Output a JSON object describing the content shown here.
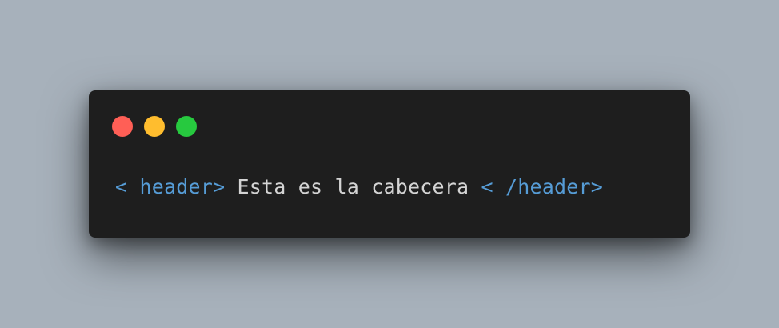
{
  "window": {
    "controls": [
      {
        "name": "close",
        "color": "#ff5f56"
      },
      {
        "name": "minimize",
        "color": "#ffbd2e"
      },
      {
        "name": "maximize",
        "color": "#27c93f"
      }
    ]
  },
  "code": {
    "open_tag": "< header>",
    "content": " Esta es la cabecera ",
    "close_tag": "< /header>",
    "colors": {
      "tag": "#569cd6",
      "text": "#d4d4d4"
    }
  }
}
